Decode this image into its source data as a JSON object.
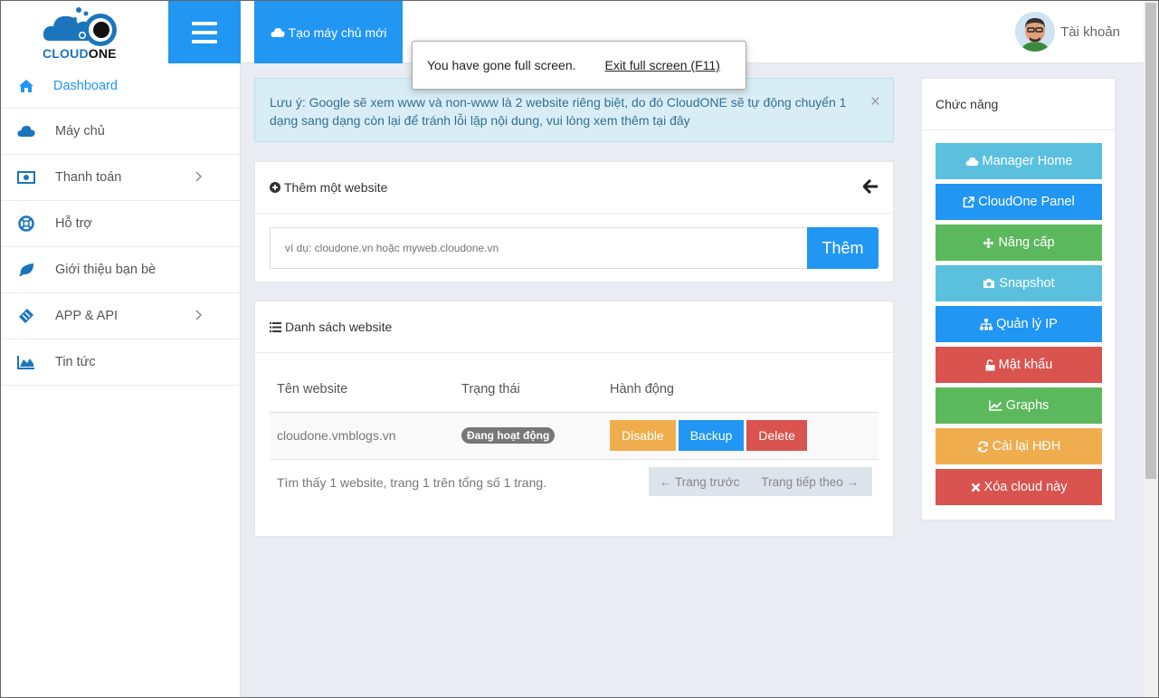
{
  "brand": {
    "logo_main": "CLOUD",
    "logo_accent": "ONE"
  },
  "topbar": {
    "new_server_label": "Tạo máy chủ mới",
    "account_label": "Tài khoản"
  },
  "fullscreen": {
    "message": "You have gone full screen.",
    "exit_label": "Exit full screen (F11)"
  },
  "sidebar": {
    "items": [
      {
        "label": "Dashboard",
        "icon": "home-icon"
      },
      {
        "label": "Máy chủ",
        "icon": "cloud-icon"
      },
      {
        "label": "Thanh toán",
        "icon": "money-icon"
      },
      {
        "label": "Hỗ trợ",
        "icon": "lifebuoy-icon"
      },
      {
        "label": "Giới thiệu bạn bè",
        "icon": "leaf-icon"
      },
      {
        "label": "APP & API",
        "icon": "ticket-icon"
      },
      {
        "label": "Tin tức",
        "icon": "area-chart-icon"
      }
    ]
  },
  "alert": {
    "text": "Lưu ý: Google sẽ xem www và non-www là 2 website riêng biệt, do đó CloudONE sẽ tự động chuyển 1 dạng sang dạng còn lại để tránh lỗi lặp nội dung, vui lòng xem thêm tại đây",
    "close": "×"
  },
  "add_website": {
    "title": "Thêm một website",
    "placeholder": "ví dụ: cloudone.vn hoặc myweb.cloudone.vn",
    "submit_label": "Thêm"
  },
  "website_list": {
    "title": "Danh sách website",
    "columns": [
      "Tên website",
      "Trạng thái",
      "Hành động"
    ],
    "rows": [
      {
        "name": "cloudone.vmblogs.vn",
        "status": "Đang hoạt động"
      }
    ],
    "actions": {
      "disable": "Disable",
      "backup": "Backup",
      "delete": "Delete"
    },
    "summary": "Tìm thấy 1 website, trang 1 trên tổng số 1 trang.",
    "prev_label": "← Trang trước",
    "next_label": "Trang tiếp theo →"
  },
  "functions": {
    "title": "Chức năng",
    "buttons": [
      {
        "label": "Manager Home",
        "icon": "cloud-icon",
        "color": "#5bc0de"
      },
      {
        "label": "CloudOne Panel",
        "icon": "external-link-icon",
        "color": "#2196f3"
      },
      {
        "label": "Nâng cấp",
        "icon": "arrows-icon",
        "color": "#5cb85c"
      },
      {
        "label": "Snapshot",
        "icon": "camera-icon",
        "color": "#5bc0de"
      },
      {
        "label": "Quản lý IP",
        "icon": "sitemap-icon",
        "color": "#2196f3"
      },
      {
        "label": "Mật khẩu",
        "icon": "unlock-icon",
        "color": "#d9534f"
      },
      {
        "label": "Graphs",
        "icon": "line-chart-icon",
        "color": "#5cb85c"
      },
      {
        "label": "Cài lại HĐH",
        "icon": "refresh-icon",
        "color": "#f0ad4e"
      },
      {
        "label": "Xóa cloud này",
        "icon": "times-icon",
        "color": "#d9534f"
      }
    ]
  }
}
